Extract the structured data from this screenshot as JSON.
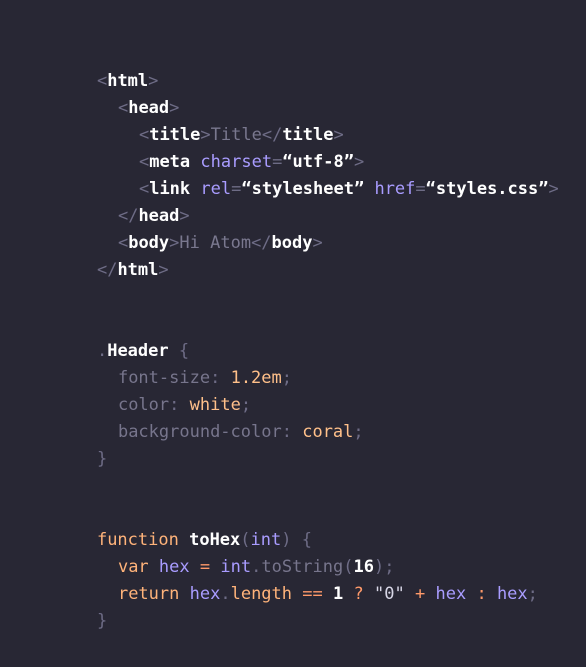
{
  "window": {
    "background": "#282734"
  },
  "html_block": {
    "l1": {
      "lt": "<",
      "tag": "html",
      "gt": ">"
    },
    "l2": {
      "lt": "<",
      "tag": "head",
      "gt": ">"
    },
    "l3": {
      "lt": "<",
      "tag": "title",
      "gt": ">",
      "text": "Title",
      "clt": "</",
      "ctag": "title",
      "cgt": ">"
    },
    "l4": {
      "lt": "<",
      "tag": "meta",
      "attr": "charset",
      "eq": "=",
      "val": "“utf-8”",
      "gt": ">"
    },
    "l5": {
      "lt": "<",
      "tag": "link",
      "attr1": "rel",
      "eq1": "=",
      "val1": "“stylesheet”",
      "attr2": "href",
      "eq2": "=",
      "val2": "“styles.css”",
      "gt": ">"
    },
    "l6": {
      "clt": "</",
      "ctag": "head",
      "cgt": ">"
    },
    "l7": {
      "lt": "<",
      "tag": "body",
      "gt": ">",
      "text": "Hi Atom",
      "clt": "</",
      "ctag": "body",
      "cgt": ">"
    },
    "l8": {
      "clt": "</",
      "ctag": "html",
      "cgt": ">"
    }
  },
  "css_block": {
    "l1": {
      "dot": ".",
      "selector": "Header",
      "brace": "{"
    },
    "l2": {
      "prop": "font-size",
      "colon": ":",
      "val": "1.2em",
      "semi": ";"
    },
    "l3": {
      "prop": "color",
      "colon": ":",
      "val": "white",
      "semi": ";"
    },
    "l4": {
      "prop": "background-color",
      "colon": ":",
      "val": "coral",
      "semi": ";"
    },
    "l5": {
      "brace": "}"
    }
  },
  "js_block": {
    "l1": {
      "kw": "function",
      "fn": "toHex",
      "lp": "(",
      "param": "int",
      "rp": ")",
      "brace": "{"
    },
    "l2": {
      "kw": "var",
      "name": "hex",
      "eq": "=",
      "obj": "int",
      "dot": ".",
      "method": "toString",
      "lp": "(",
      "num": "16",
      "rp": ")",
      "semi": ";"
    },
    "l3": {
      "kw": "return",
      "obj": "hex",
      "dot": ".",
      "prop": "length",
      "eqeq": "==",
      "num": "1",
      "q": "?",
      "str": "\"0\"",
      "plus": "+",
      "name1": "hex",
      "colon": ":",
      "name2": "hex",
      "semi": ";"
    },
    "l4": {
      "brace": "}"
    }
  }
}
